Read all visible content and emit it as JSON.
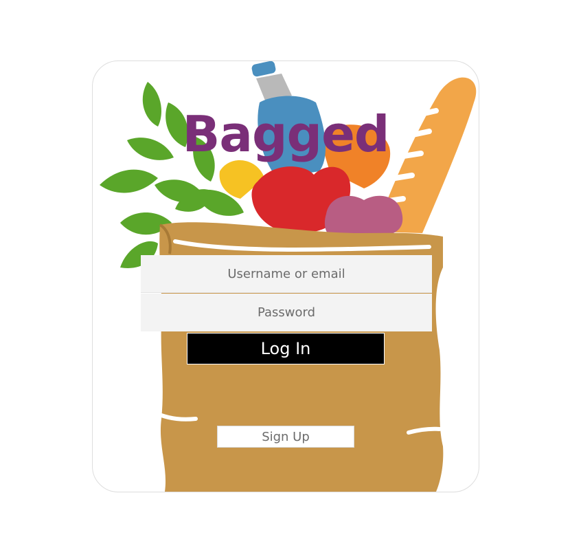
{
  "brand": {
    "title": "Bagged",
    "title_color": "#7a2f78"
  },
  "login_form": {
    "username_placeholder": "Username or email",
    "password_placeholder": "Password",
    "login_label": "Log In",
    "signup_label": "Sign Up"
  },
  "illustration": {
    "icon": "grocery-bag-icon",
    "colors": {
      "bag": "#c8964a",
      "leaves": "#5aa62a",
      "bottle": "#4a8fbf",
      "bread": "#f2a649",
      "apple": "#d9282b",
      "plum": "#b85d83",
      "orange": "#f08228",
      "lemon": "#f6c223"
    }
  }
}
